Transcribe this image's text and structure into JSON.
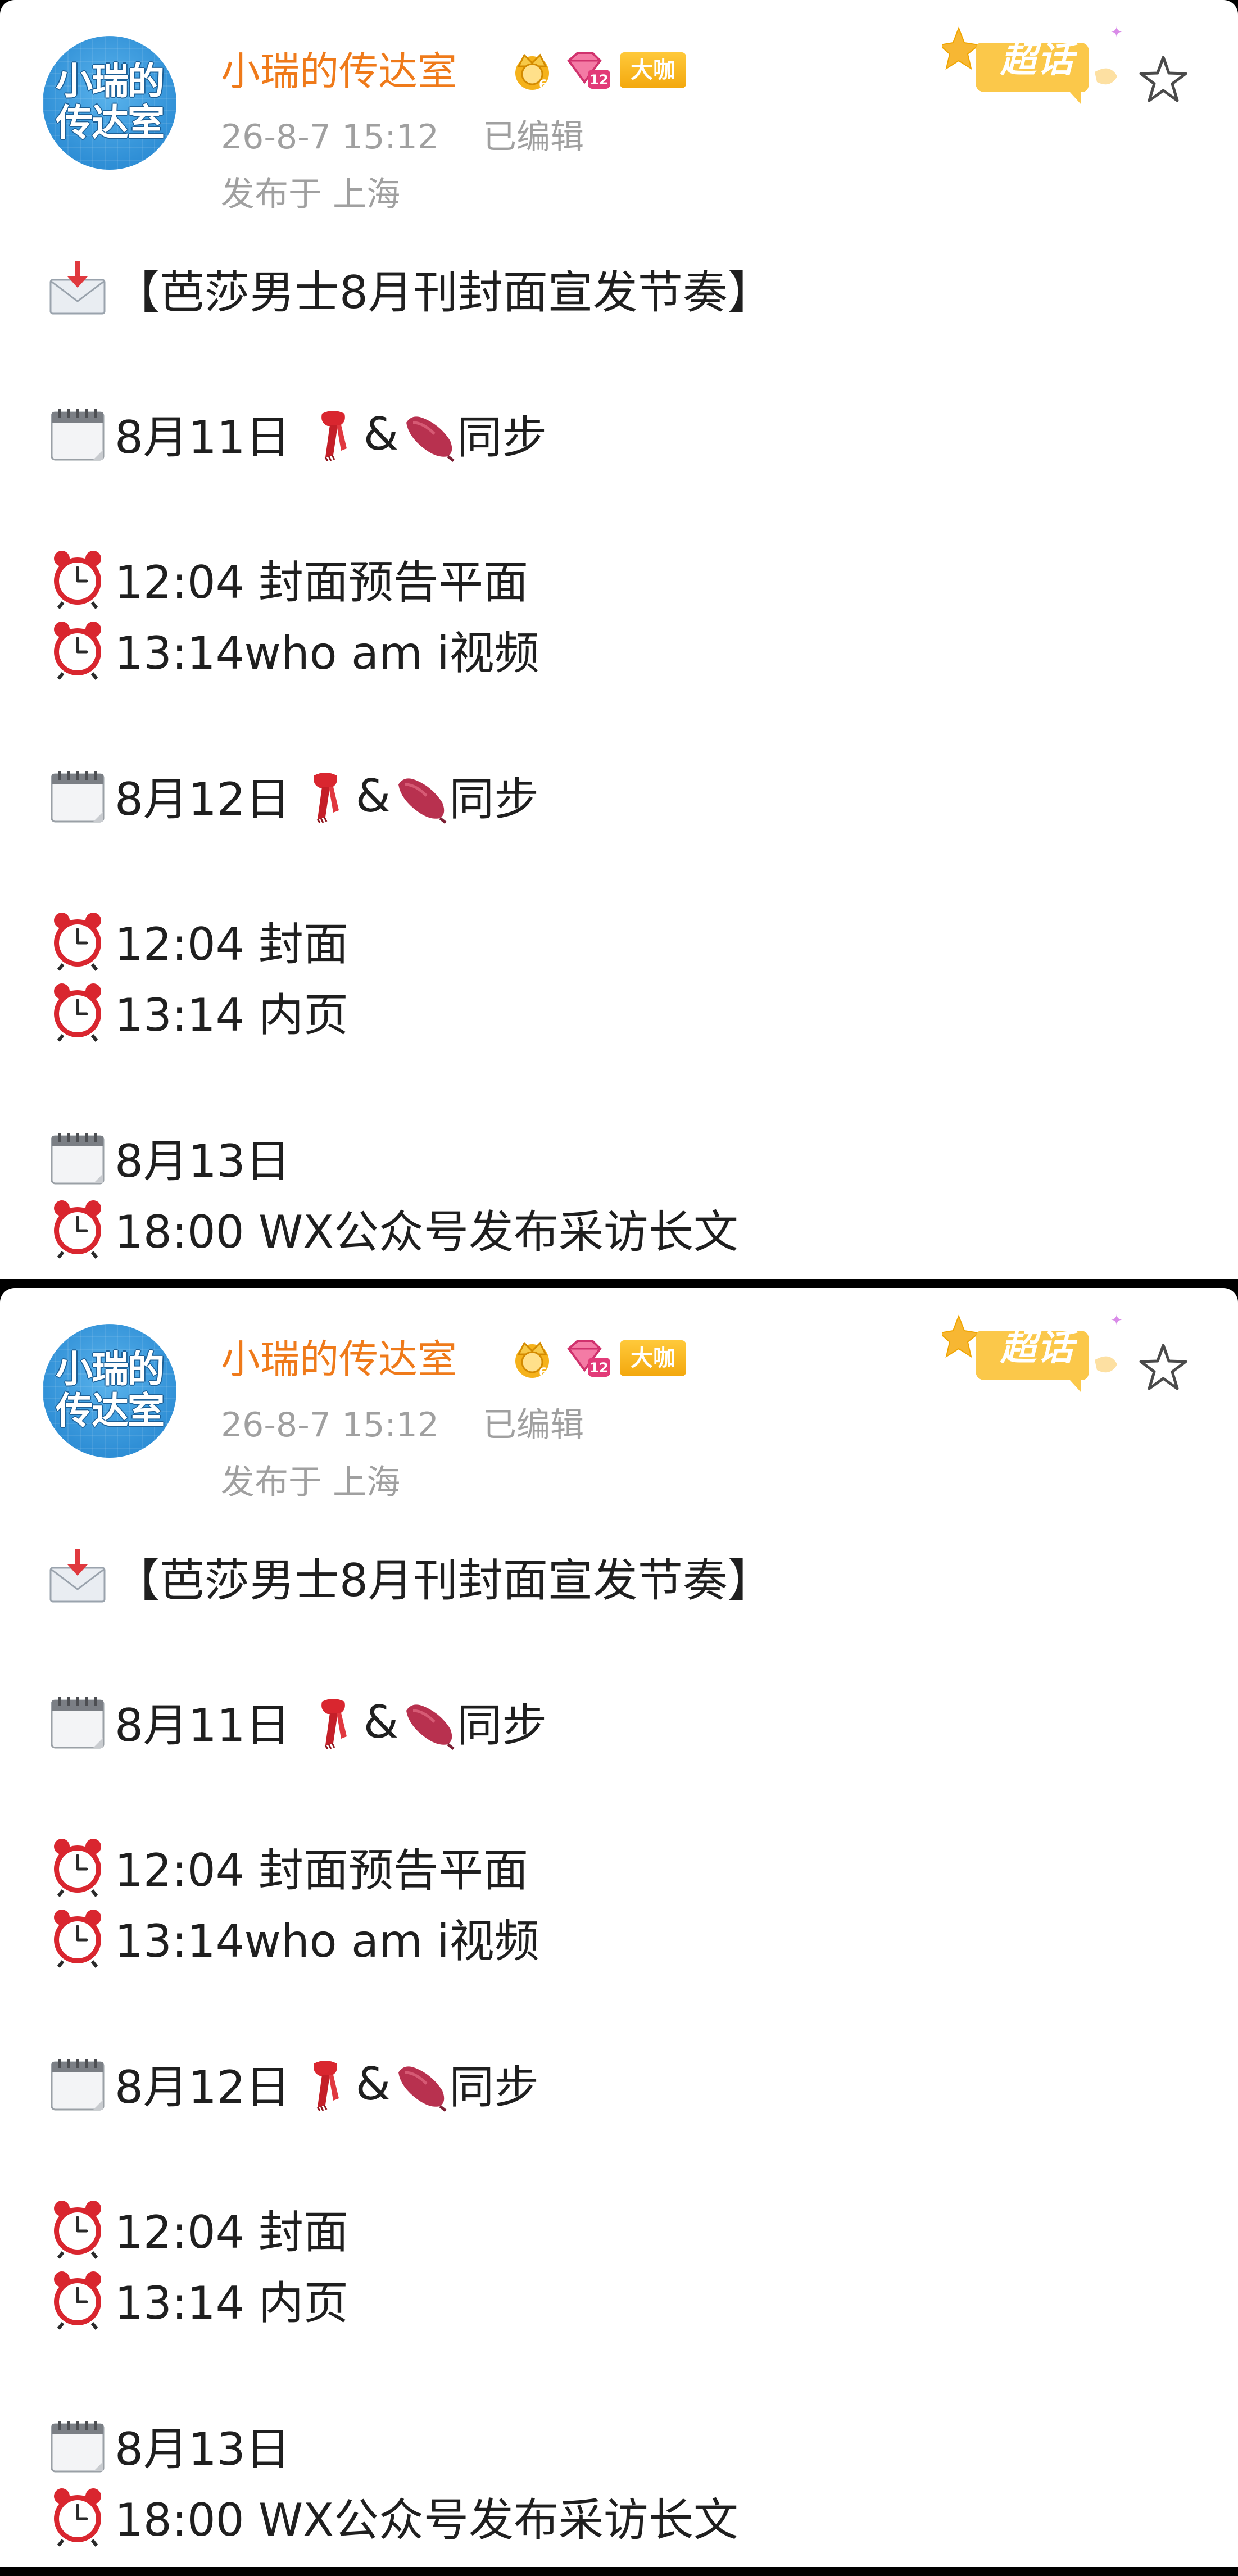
{
  "post": {
    "user": {
      "name": "小瑞的传达室",
      "avatar_line1": "小瑞的",
      "avatar_line2": "传达室",
      "badges": {
        "level": "12",
        "vip": "大咖"
      }
    },
    "time": "26-8-7 15:12",
    "edited": "已编辑",
    "location": "发布于 上海",
    "supertopic": "超话",
    "icons": {
      "envelope": "incoming-envelope-icon",
      "calendar": "calendar-icon",
      "clock": "alarm-clock-icon",
      "scarf": "scarf-icon",
      "sweet_potato": "sweet-potato-icon",
      "favorite": "star-outline-icon"
    },
    "colors": {
      "username": "#ef7a1a",
      "meta": "#a0a0a0",
      "text": "#1f1f1f",
      "badge_gold": "#f3a80e",
      "avatar_blue": "#2f8fd6"
    },
    "content": {
      "title": "【芭莎男士8月刊封面宣发节奏】",
      "day1": {
        "date": "8月11日",
        "amp": "&",
        "sync": "同步"
      },
      "day1_items": [
        "12:04 封面预告平面",
        "13:14who am i视频"
      ],
      "day2": {
        "date": "8月12日",
        "amp": "&",
        "sync": "同步"
      },
      "day2_items": [
        "12:04 封面",
        "13:14 内页"
      ],
      "day3": {
        "date": "8月13日"
      },
      "day3_items": [
        "18:00 WX公众号发布采访长文"
      ]
    }
  }
}
